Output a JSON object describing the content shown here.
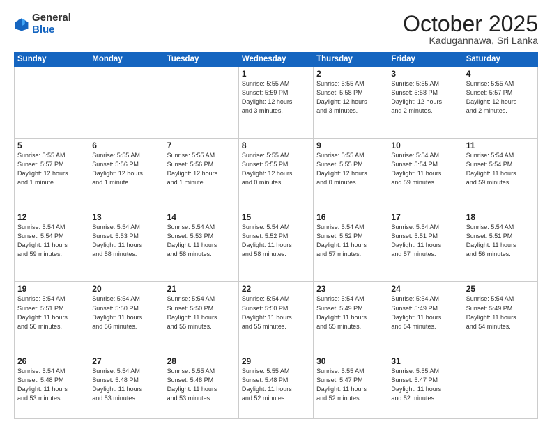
{
  "header": {
    "logo_general": "General",
    "logo_blue": "Blue",
    "month": "October 2025",
    "location": "Kadugannawa, Sri Lanka"
  },
  "weekdays": [
    "Sunday",
    "Monday",
    "Tuesday",
    "Wednesday",
    "Thursday",
    "Friday",
    "Saturday"
  ],
  "weeks": [
    [
      {
        "day": "",
        "info": ""
      },
      {
        "day": "",
        "info": ""
      },
      {
        "day": "",
        "info": ""
      },
      {
        "day": "1",
        "info": "Sunrise: 5:55 AM\nSunset: 5:59 PM\nDaylight: 12 hours\nand 3 minutes."
      },
      {
        "day": "2",
        "info": "Sunrise: 5:55 AM\nSunset: 5:58 PM\nDaylight: 12 hours\nand 3 minutes."
      },
      {
        "day": "3",
        "info": "Sunrise: 5:55 AM\nSunset: 5:58 PM\nDaylight: 12 hours\nand 2 minutes."
      },
      {
        "day": "4",
        "info": "Sunrise: 5:55 AM\nSunset: 5:57 PM\nDaylight: 12 hours\nand 2 minutes."
      }
    ],
    [
      {
        "day": "5",
        "info": "Sunrise: 5:55 AM\nSunset: 5:57 PM\nDaylight: 12 hours\nand 1 minute."
      },
      {
        "day": "6",
        "info": "Sunrise: 5:55 AM\nSunset: 5:56 PM\nDaylight: 12 hours\nand 1 minute."
      },
      {
        "day": "7",
        "info": "Sunrise: 5:55 AM\nSunset: 5:56 PM\nDaylight: 12 hours\nand 1 minute."
      },
      {
        "day": "8",
        "info": "Sunrise: 5:55 AM\nSunset: 5:55 PM\nDaylight: 12 hours\nand 0 minutes."
      },
      {
        "day": "9",
        "info": "Sunrise: 5:55 AM\nSunset: 5:55 PM\nDaylight: 12 hours\nand 0 minutes."
      },
      {
        "day": "10",
        "info": "Sunrise: 5:54 AM\nSunset: 5:54 PM\nDaylight: 11 hours\nand 59 minutes."
      },
      {
        "day": "11",
        "info": "Sunrise: 5:54 AM\nSunset: 5:54 PM\nDaylight: 11 hours\nand 59 minutes."
      }
    ],
    [
      {
        "day": "12",
        "info": "Sunrise: 5:54 AM\nSunset: 5:54 PM\nDaylight: 11 hours\nand 59 minutes."
      },
      {
        "day": "13",
        "info": "Sunrise: 5:54 AM\nSunset: 5:53 PM\nDaylight: 11 hours\nand 58 minutes."
      },
      {
        "day": "14",
        "info": "Sunrise: 5:54 AM\nSunset: 5:53 PM\nDaylight: 11 hours\nand 58 minutes."
      },
      {
        "day": "15",
        "info": "Sunrise: 5:54 AM\nSunset: 5:52 PM\nDaylight: 11 hours\nand 58 minutes."
      },
      {
        "day": "16",
        "info": "Sunrise: 5:54 AM\nSunset: 5:52 PM\nDaylight: 11 hours\nand 57 minutes."
      },
      {
        "day": "17",
        "info": "Sunrise: 5:54 AM\nSunset: 5:51 PM\nDaylight: 11 hours\nand 57 minutes."
      },
      {
        "day": "18",
        "info": "Sunrise: 5:54 AM\nSunset: 5:51 PM\nDaylight: 11 hours\nand 56 minutes."
      }
    ],
    [
      {
        "day": "19",
        "info": "Sunrise: 5:54 AM\nSunset: 5:51 PM\nDaylight: 11 hours\nand 56 minutes."
      },
      {
        "day": "20",
        "info": "Sunrise: 5:54 AM\nSunset: 5:50 PM\nDaylight: 11 hours\nand 56 minutes."
      },
      {
        "day": "21",
        "info": "Sunrise: 5:54 AM\nSunset: 5:50 PM\nDaylight: 11 hours\nand 55 minutes."
      },
      {
        "day": "22",
        "info": "Sunrise: 5:54 AM\nSunset: 5:50 PM\nDaylight: 11 hours\nand 55 minutes."
      },
      {
        "day": "23",
        "info": "Sunrise: 5:54 AM\nSunset: 5:49 PM\nDaylight: 11 hours\nand 55 minutes."
      },
      {
        "day": "24",
        "info": "Sunrise: 5:54 AM\nSunset: 5:49 PM\nDaylight: 11 hours\nand 54 minutes."
      },
      {
        "day": "25",
        "info": "Sunrise: 5:54 AM\nSunset: 5:49 PM\nDaylight: 11 hours\nand 54 minutes."
      }
    ],
    [
      {
        "day": "26",
        "info": "Sunrise: 5:54 AM\nSunset: 5:48 PM\nDaylight: 11 hours\nand 53 minutes."
      },
      {
        "day": "27",
        "info": "Sunrise: 5:54 AM\nSunset: 5:48 PM\nDaylight: 11 hours\nand 53 minutes."
      },
      {
        "day": "28",
        "info": "Sunrise: 5:55 AM\nSunset: 5:48 PM\nDaylight: 11 hours\nand 53 minutes."
      },
      {
        "day": "29",
        "info": "Sunrise: 5:55 AM\nSunset: 5:48 PM\nDaylight: 11 hours\nand 52 minutes."
      },
      {
        "day": "30",
        "info": "Sunrise: 5:55 AM\nSunset: 5:47 PM\nDaylight: 11 hours\nand 52 minutes."
      },
      {
        "day": "31",
        "info": "Sunrise: 5:55 AM\nSunset: 5:47 PM\nDaylight: 11 hours\nand 52 minutes."
      },
      {
        "day": "",
        "info": ""
      }
    ]
  ]
}
